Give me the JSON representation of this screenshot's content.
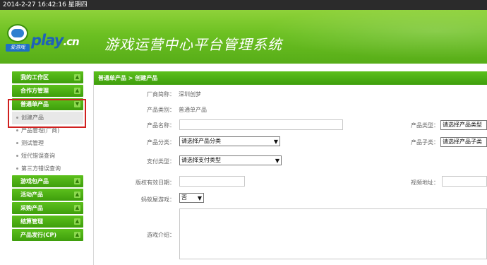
{
  "topbar": {
    "datetime": "2014-2-27 16:42:16  星期四"
  },
  "header": {
    "logo_sub": "爱游戏",
    "logo_play": "play",
    "logo_cn": ".cn",
    "title": "游戏运营中心平台管理系统"
  },
  "sidebar": {
    "groups": [
      {
        "label": "我的工作区",
        "arrow": "▲"
      },
      {
        "label": "合作方管理",
        "arrow": "▲"
      },
      {
        "label": "普通单产品",
        "arrow": "▼"
      },
      {
        "label": "游戏包产品",
        "arrow": "▲"
      },
      {
        "label": "活动产品",
        "arrow": "▲"
      },
      {
        "label": "采购产品",
        "arrow": "▲"
      },
      {
        "label": "结算管理",
        "arrow": "▲"
      },
      {
        "label": "产品发行(CP)",
        "arrow": "▲"
      }
    ],
    "subitems": [
      {
        "label": "创建产品"
      },
      {
        "label": "产品管理(厂商)"
      },
      {
        "label": "测试管理"
      },
      {
        "label": "短代错误查询"
      },
      {
        "label": "第三方错误查询"
      }
    ]
  },
  "panel": {
    "breadcrumb": "普通单产品 > 创建产品",
    "vendor_label": "厂商简称：",
    "vendor_value": "深圳创梦",
    "category_label": "产品类别：",
    "category_value": "普通单产品",
    "name_label": "产品名称：",
    "product_type_label": "产品类型：",
    "product_type_select": "请选择产品类型",
    "classify_label": "产品分类：",
    "classify_select": "请选择产品分类",
    "subtype_label": "产品子类：",
    "subtype_select": "请选择产品子类",
    "pay_label": "支付类型：",
    "pay_select": "请选择支付类型",
    "copyright_label": "版权有效日期：",
    "video_label": "视频地址：",
    "ant_label": "蚂蚁屋游戏：",
    "ant_select": "否",
    "intro_label": "游戏介绍："
  }
}
